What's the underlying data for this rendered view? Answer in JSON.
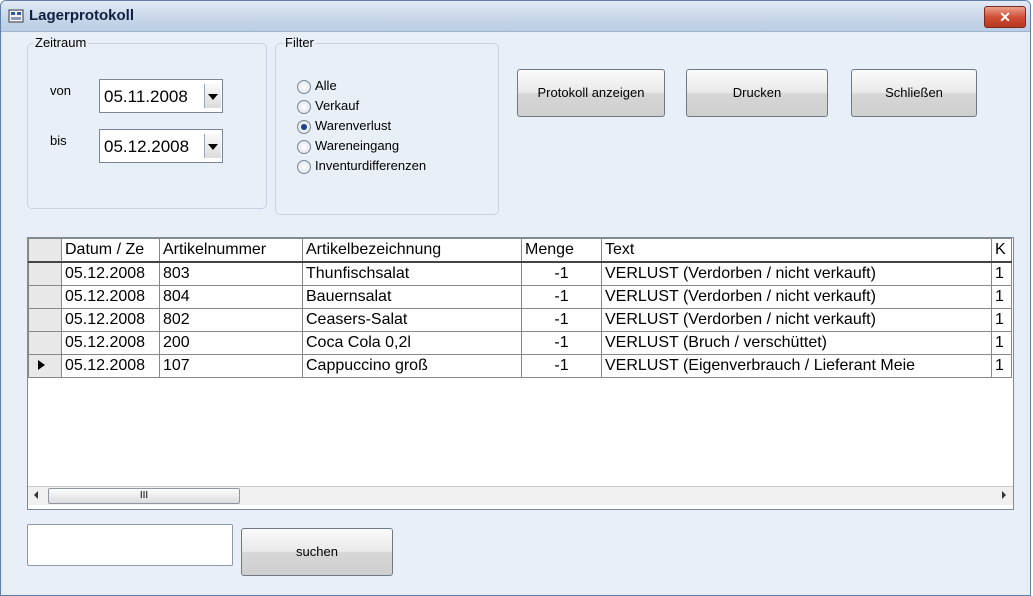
{
  "window": {
    "title": "Lagerprotokoll",
    "close_glyph": "✕"
  },
  "zeitraum": {
    "legend": "Zeitraum",
    "von_label": "von",
    "von_value": "05.11.2008",
    "bis_label": "bis",
    "bis_value": "05.12.2008"
  },
  "filter": {
    "legend": "Filter",
    "options": [
      "Alle",
      "Verkauf",
      "Warenverlust",
      "Wareneingang",
      "Inventurdifferenzen"
    ],
    "selected": "Warenverlust"
  },
  "buttons": {
    "show": "Protokoll anzeigen",
    "print": "Drucken",
    "close": "Schließen"
  },
  "grid": {
    "columns": [
      "Datum / Ze",
      "Artikelnummer",
      "Artikelbezeichnung",
      "Menge",
      "Text",
      "K"
    ],
    "rows": [
      [
        "05.12.2008",
        "803",
        "Thunfischsalat",
        "-1",
        "VERLUST (Verdorben / nicht verkauft)",
        "1"
      ],
      [
        "05.12.2008",
        "804",
        "Bauernsalat",
        "-1",
        "VERLUST (Verdorben / nicht verkauft)",
        "1"
      ],
      [
        "05.12.2008",
        "802",
        "Ceasers-Salat",
        "-1",
        "VERLUST (Verdorben / nicht verkauft)",
        "1"
      ],
      [
        "05.12.2008",
        "200",
        "Coca Cola 0,2l",
        "-1",
        "VERLUST (Bruch / verschüttet)",
        "1"
      ],
      [
        "05.12.2008",
        "107",
        "Cappuccino groß",
        "-1",
        "VERLUST (Eigenverbrauch / Lieferant Meie",
        "1"
      ]
    ],
    "current_row": 4,
    "scroll_thumb_glyph": "III"
  },
  "search": {
    "value": "",
    "button": "suchen"
  }
}
